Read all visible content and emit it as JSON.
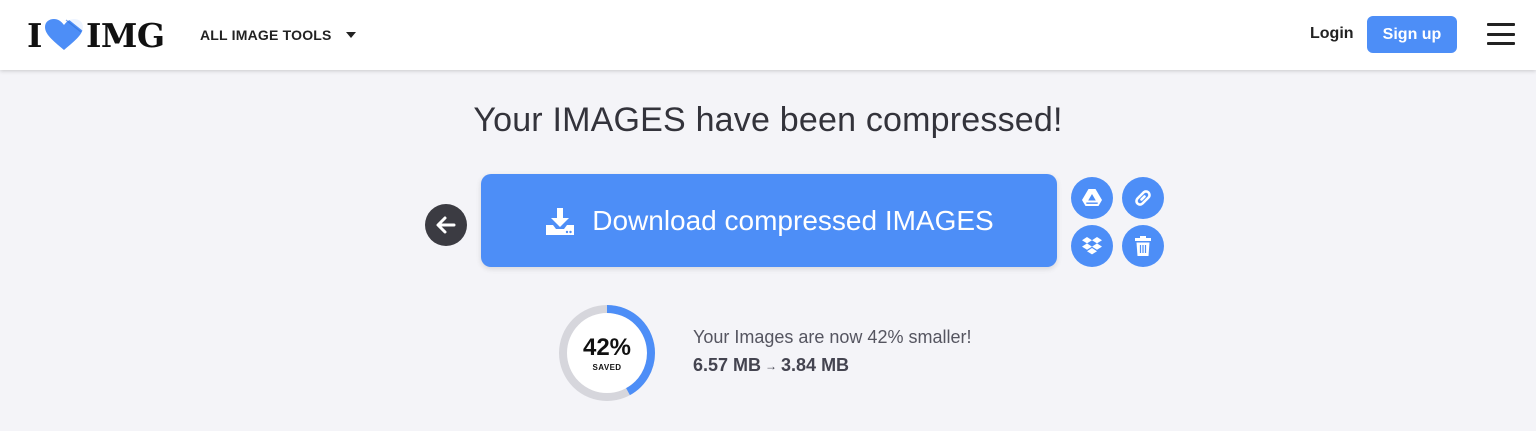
{
  "header": {
    "logo_left": "I",
    "logo_right": "IMG",
    "tools_label": "ALL IMAGE TOOLS",
    "login_label": "Login",
    "signup_label": "Sign up"
  },
  "main": {
    "title": "Your IMAGES have been compressed!",
    "download_label": "Download compressed IMAGES"
  },
  "savings": {
    "percent_label": "42%",
    "percent_value": 0.42,
    "saved_label": "SAVED",
    "message": "Your Images are now 42% smaller!",
    "original_size": "6.57 MB",
    "arrow": "→",
    "new_size": "3.84 MB"
  },
  "icons": {
    "back": "arrow-left-icon",
    "download": "download-tray-icon",
    "gdrive": "google-drive-icon",
    "link": "link-icon",
    "dropbox": "dropbox-icon",
    "delete": "trash-icon",
    "menu": "hamburger-icon"
  },
  "colors": {
    "accent": "#4d8ef7",
    "background": "#f4f4f8",
    "dark_button": "#3b3b42",
    "ring_track": "#d6d6dc"
  }
}
